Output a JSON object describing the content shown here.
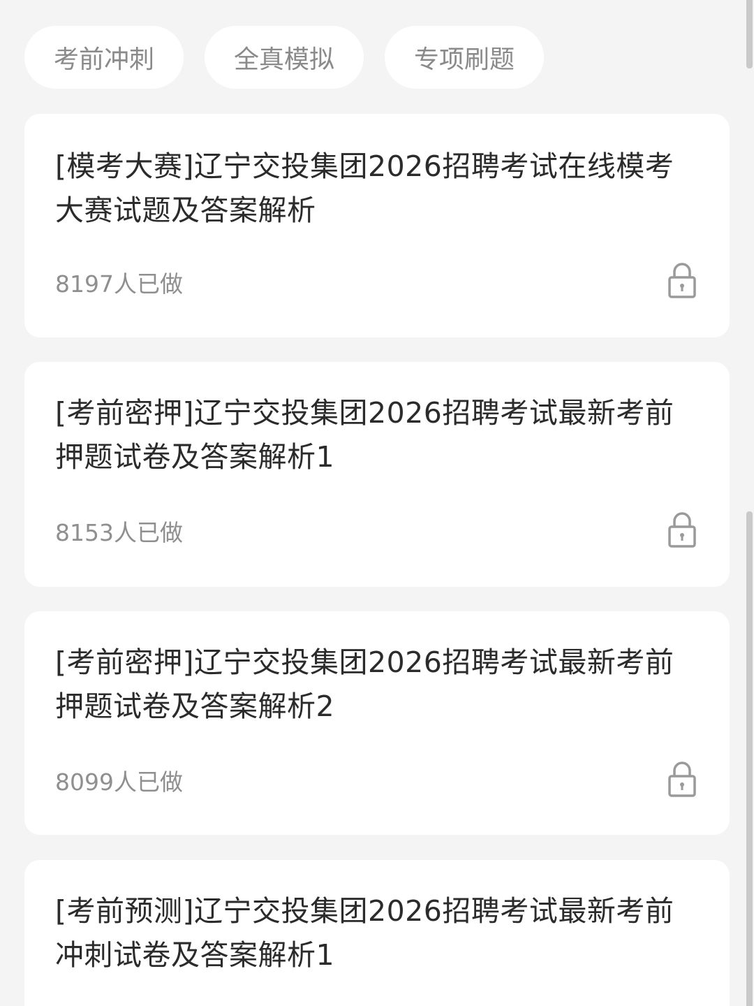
{
  "tabs": [
    {
      "label": "考前冲刺"
    },
    {
      "label": "全真模拟"
    },
    {
      "label": "专项刷题"
    }
  ],
  "cards": [
    {
      "title": "[模考大赛]辽宁交投集团2026招聘考试在线模考大赛试题及答案解析",
      "count": "8197人已做",
      "icon": "lock-icon"
    },
    {
      "title": "[考前密押]辽宁交投集团2026招聘考试最新考前押题试卷及答案解析1",
      "count": "8153人已做",
      "icon": "lock-icon"
    },
    {
      "title": "[考前密押]辽宁交投集团2026招聘考试最新考前押题试卷及答案解析2",
      "count": "8099人已做",
      "icon": "lock-icon"
    },
    {
      "title": "[考前预测]辽宁交投集团2026招聘考试最新考前冲刺试卷及答案解析1",
      "count": "",
      "icon": "lock-icon"
    }
  ]
}
